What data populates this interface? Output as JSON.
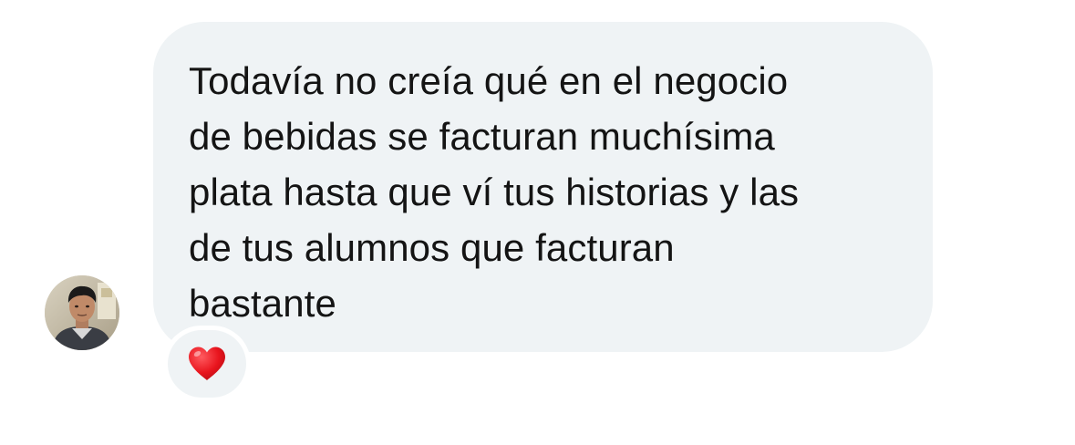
{
  "message": {
    "lines": [
      "Todavía no creía qué en el negocio",
      "de bebidas se facturan muchísima",
      "plata hasta que ví tus historias y las",
      "de tus alumnos que facturan",
      "bastante"
    ]
  },
  "sender": {
    "avatar_icon": "person-photo"
  },
  "reaction": {
    "icon": "red-heart-icon",
    "color": "#e8141d"
  },
  "colors": {
    "bubble_background": "#eff3f5",
    "text": "#141414"
  }
}
